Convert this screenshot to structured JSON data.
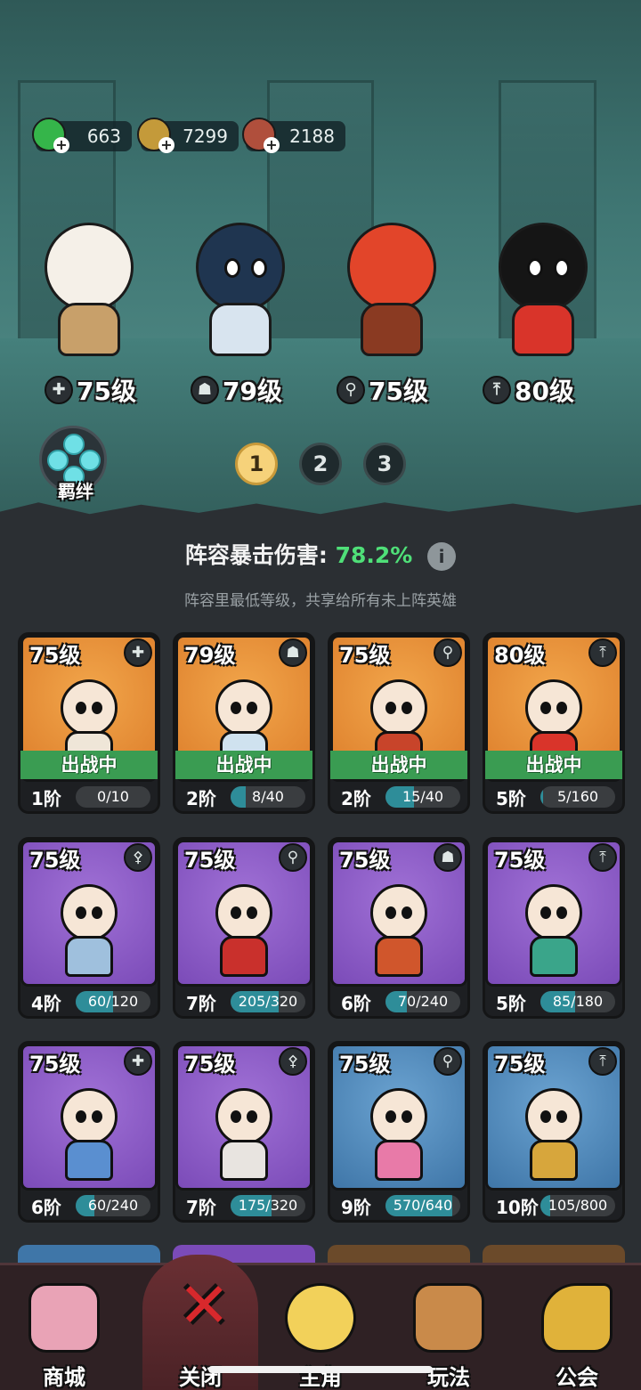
{
  "resources": [
    {
      "name": "jade",
      "value": "663",
      "color": "#35b54a",
      "icon": "green-gem-icon"
    },
    {
      "name": "coin",
      "value": "7299",
      "color": "#c49a3a",
      "icon": "copper-coin-icon"
    },
    {
      "name": "book",
      "value": "2188",
      "color": "#b04f3c",
      "icon": "skill-book-icon"
    }
  ],
  "lineup": [
    {
      "level": "75级",
      "class_icon": "plus-icon",
      "class_glyph": "✚",
      "hair": "#f5f0e8",
      "outfit": "#c8a06a"
    },
    {
      "level": "79级",
      "class_icon": "skull-icon",
      "class_glyph": "☗",
      "hair": "#1f3550",
      "outfit": "#d8e4ef"
    },
    {
      "level": "75级",
      "class_icon": "staff-icon",
      "class_glyph": "⚲",
      "hair": "#e2452a",
      "outfit": "#8a3a22"
    },
    {
      "level": "80级",
      "class_icon": "arrow-up-icon",
      "class_glyph": "⤒",
      "hair": "#151515",
      "outfit": "#d9342a"
    }
  ],
  "bond_label": "羁绊",
  "pages": [
    "1",
    "2",
    "3"
  ],
  "active_page": "1",
  "crit": {
    "label": "阵容暴击伤害:",
    "value": "78.2%"
  },
  "hint": "阵容里最低等级，共享给所有未上阵英雄",
  "cards": [
    {
      "level": "75级",
      "class_glyph": "✚",
      "class_icon": "plus-icon",
      "theme": "orange",
      "status": "出战中",
      "tier": "1阶",
      "progress": "0/10",
      "fill": 0.0,
      "skin": "#efe6d8"
    },
    {
      "level": "79级",
      "class_glyph": "☗",
      "class_icon": "skull-icon",
      "theme": "orange",
      "status": "出战中",
      "tier": "2阶",
      "progress": "8/40",
      "fill": 0.2,
      "skin": "#cfe2ef"
    },
    {
      "level": "75级",
      "class_glyph": "⚲",
      "class_icon": "staff-icon",
      "theme": "orange",
      "status": "出战中",
      "tier": "2阶",
      "progress": "15/40",
      "fill": 0.375,
      "skin": "#c8442a"
    },
    {
      "level": "80级",
      "class_glyph": "⤒",
      "class_icon": "arrow-up-icon",
      "theme": "orange",
      "status": "出战中",
      "tier": "5阶",
      "progress": "5/160",
      "fill": 0.03,
      "skin": "#d9342a"
    },
    {
      "level": "75级",
      "class_glyph": "⚴",
      "class_icon": "mage-icon",
      "theme": "purple",
      "status": "",
      "tier": "4阶",
      "progress": "60/120",
      "fill": 0.5,
      "skin": "#9fc0dd"
    },
    {
      "level": "75级",
      "class_glyph": "⚲",
      "class_icon": "staff-icon",
      "theme": "purple",
      "status": "",
      "tier": "7阶",
      "progress": "205/320",
      "fill": 0.64,
      "skin": "#c9302c"
    },
    {
      "level": "75级",
      "class_glyph": "☗",
      "class_icon": "skull-icon",
      "theme": "purple",
      "status": "",
      "tier": "6阶",
      "progress": "70/240",
      "fill": 0.29,
      "skin": "#d0562c"
    },
    {
      "level": "75级",
      "class_glyph": "⤒",
      "class_icon": "arrow-up-icon",
      "theme": "purple",
      "status": "",
      "tier": "5阶",
      "progress": "85/180",
      "fill": 0.47,
      "skin": "#3aa58a"
    },
    {
      "level": "75级",
      "class_glyph": "✚",
      "class_icon": "plus-icon",
      "theme": "purple",
      "status": "",
      "tier": "6阶",
      "progress": "60/240",
      "fill": 0.25,
      "skin": "#5a8fd0"
    },
    {
      "level": "75级",
      "class_glyph": "⚴",
      "class_icon": "mage-icon",
      "theme": "purple",
      "status": "",
      "tier": "7阶",
      "progress": "175/320",
      "fill": 0.55,
      "skin": "#e8e4e0"
    },
    {
      "level": "75级",
      "class_glyph": "⚲",
      "class_icon": "staff-icon",
      "theme": "blue",
      "status": "",
      "tier": "9阶",
      "progress": "570/640",
      "fill": 0.89,
      "skin": "#e87aa8"
    },
    {
      "level": "75级",
      "class_glyph": "⤒",
      "class_icon": "arrow-up-icon",
      "theme": "blue",
      "status": "",
      "tier": "10阶",
      "progress": "105/800",
      "fill": 0.13,
      "skin": "#d7a63c"
    }
  ],
  "partial_row": [
    {
      "theme": "blue"
    },
    {
      "theme": "purple"
    },
    {
      "theme": "brown"
    },
    {
      "theme": "brown"
    }
  ],
  "nav": [
    {
      "label": "商城",
      "icon": "lucky-cat-icon",
      "color": "#e9a3b6"
    },
    {
      "label": "关闭",
      "icon": "close-icon",
      "color": "#d8282c",
      "active": true
    },
    {
      "label": "主角",
      "icon": "chick-icon",
      "color": "#f2d15a"
    },
    {
      "label": "玩法",
      "icon": "tv-icon",
      "color": "#c98a4a"
    },
    {
      "label": "公会",
      "icon": "gramophone-icon",
      "color": "#e0b23a"
    }
  ]
}
